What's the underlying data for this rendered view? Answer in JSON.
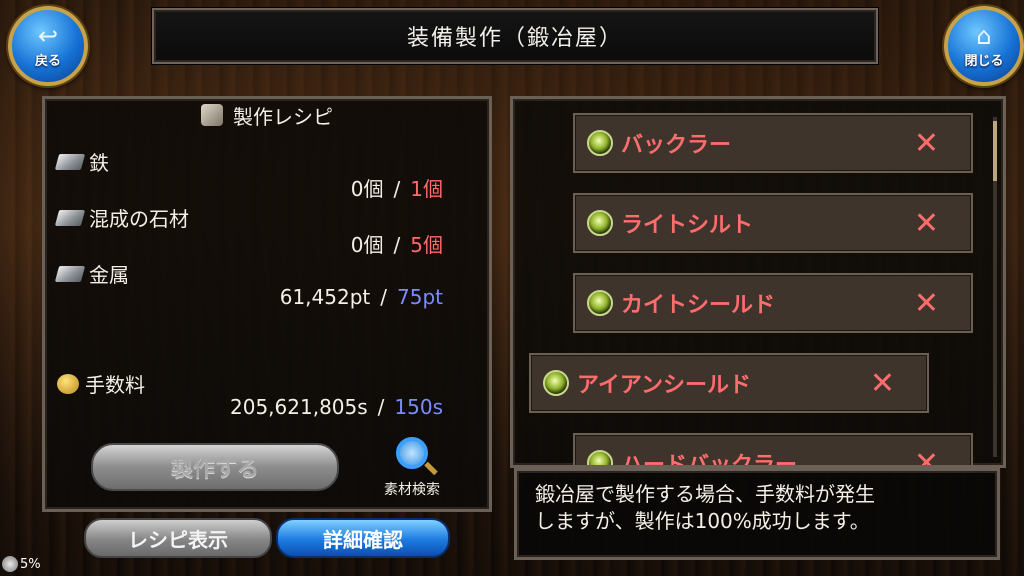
{
  "header": {
    "title": "装備製作（鍛冶屋）"
  },
  "nav": {
    "back_label": "戻る",
    "close_label": "閉じる"
  },
  "recipe": {
    "heading": "製作レシピ",
    "materials": [
      {
        "name": "鉄",
        "owned": "0個",
        "required": "1個",
        "icon": "ingot-icon"
      },
      {
        "name": "混成の石材",
        "owned": "0個",
        "required": "5個",
        "icon": "ingot-icon"
      },
      {
        "name": "金属",
        "owned": "61,452pt",
        "required": "75pt",
        "icon": "ingot-icon"
      }
    ],
    "fee": {
      "name": "手数料",
      "owned": "205,621,805s",
      "required": "150s",
      "icon": "coin-icon"
    },
    "separator": "/",
    "craft_label": "製作する",
    "search_label": "素材検索"
  },
  "bottom": {
    "recipe_view_label": "レシピ表示",
    "detail_label": "詳細確認",
    "progress": "5%"
  },
  "items": [
    {
      "name": "バックラー",
      "mark": "✕"
    },
    {
      "name": "ライトシルト",
      "mark": "✕"
    },
    {
      "name": "カイトシールド",
      "mark": "✕"
    },
    {
      "name": "アイアンシールド",
      "mark": "✕"
    },
    {
      "name": "ハードバックラー",
      "mark": "✕"
    }
  ],
  "info": {
    "line1": "鍛冶屋で製作する場合、手数料が発生",
    "line2": "しますが、製作は100%成功します。"
  },
  "colors": {
    "required_short": "#ff6a6a",
    "required_ok": "#7a8cff",
    "item_text": "#ff6d6d",
    "accent_blue": "#1e7be0"
  }
}
